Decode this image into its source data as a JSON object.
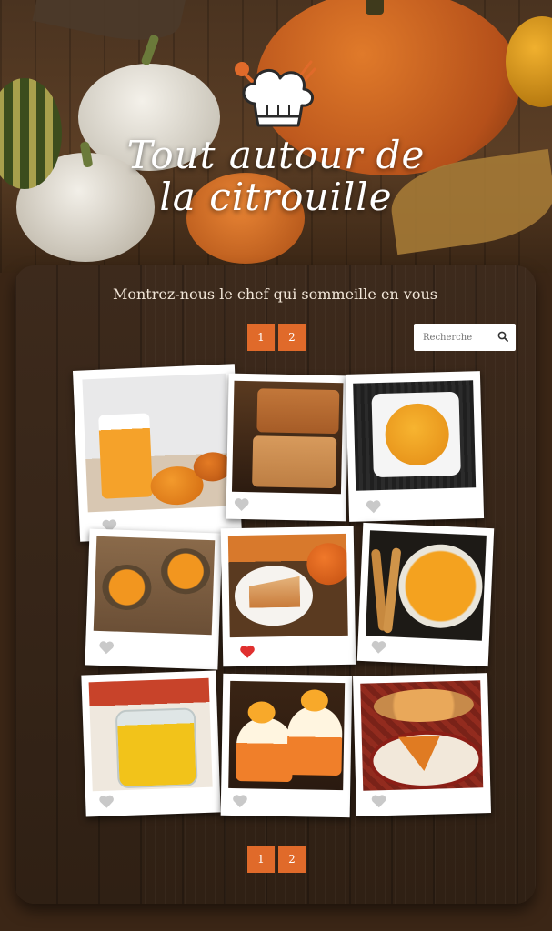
{
  "hero": {
    "title_line1": "Tout autour de",
    "title_line2": "la citrouille"
  },
  "tagline": "Montrez-nous le chef qui sommeille en vous",
  "pagination": [
    "1",
    "2"
  ],
  "search": {
    "placeholder": "Recherche"
  },
  "colors": {
    "accent": "#e06a2a",
    "liked": "#e0302f",
    "unliked": "#c9c9c9"
  },
  "gallery": [
    {
      "subject": "pumpkin-smoothie",
      "liked": false
    },
    {
      "subject": "pumpkin-bread",
      "liked": false
    },
    {
      "subject": "pumpkin-soup-square-plate",
      "liked": false
    },
    {
      "subject": "pumpkin-soup-pots",
      "liked": false
    },
    {
      "subject": "pumpkin-pie-slice",
      "liked": true
    },
    {
      "subject": "pumpkin-soup-breadsticks",
      "liked": false
    },
    {
      "subject": "pumpkin-jar-dessert",
      "liked": false
    },
    {
      "subject": "pumpkin-cupcakes",
      "liked": false
    },
    {
      "subject": "pumpkin-pie-plate",
      "liked": false
    }
  ]
}
